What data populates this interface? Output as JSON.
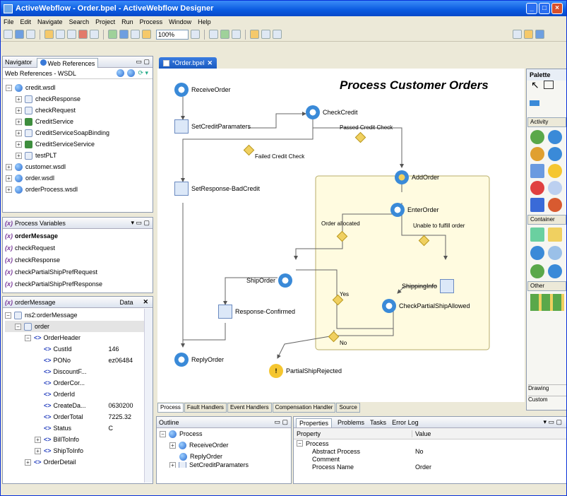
{
  "window": {
    "title": "ActiveWebflow - Order.bpel - ActiveWebflow Designer"
  },
  "menu": [
    "File",
    "Edit",
    "Navigate",
    "Search",
    "Project",
    "Run",
    "Process",
    "Window",
    "Help"
  ],
  "toolbar": {
    "zoom": "100%"
  },
  "navigator": {
    "tabs": [
      "Navigator",
      "Web References"
    ],
    "subtitle": "Web References - WSDL",
    "items": [
      {
        "label": "credit.wsdl",
        "level": 0,
        "exp": "−",
        "icon": "globe"
      },
      {
        "label": "checkResponse",
        "level": 1,
        "exp": "+",
        "icon": "doc"
      },
      {
        "label": "checkRequest",
        "level": 1,
        "exp": "+",
        "icon": "doc"
      },
      {
        "label": "CreditService",
        "level": 1,
        "exp": "+",
        "icon": "svc"
      },
      {
        "label": "CreditServiceSoapBinding",
        "level": 1,
        "exp": "+",
        "icon": "doc"
      },
      {
        "label": "CreditServiceService",
        "level": 1,
        "exp": "+",
        "icon": "svc"
      },
      {
        "label": "testPLT",
        "level": 1,
        "exp": "+",
        "icon": "doc"
      },
      {
        "label": "customer.wsdl",
        "level": 0,
        "exp": "+",
        "icon": "globe"
      },
      {
        "label": "order.wsdl",
        "level": 0,
        "exp": "+",
        "icon": "globe"
      },
      {
        "label": "orderProcess.wsdl",
        "level": 0,
        "exp": "+",
        "icon": "globe"
      }
    ]
  },
  "variables": {
    "title": "Process Variables",
    "items": [
      "orderMessage",
      "checkRequest",
      "checkResponse",
      "checkPartialShipPrefRequest",
      "checkPartialShipPrefResponse"
    ]
  },
  "data_view": {
    "title": "orderMessage",
    "col": "Data",
    "rows": [
      {
        "label": "ns2:orderMessage",
        "level": 0,
        "exp": "−",
        "value": ""
      },
      {
        "label": "order",
        "level": 1,
        "exp": "−",
        "value": ""
      },
      {
        "label": "OrderHeader",
        "level": 2,
        "exp": "−",
        "value": ""
      },
      {
        "label": "CustId",
        "level": 3,
        "exp": "",
        "value": "146"
      },
      {
        "label": "PONo",
        "level": 3,
        "exp": "",
        "value": "ez06484"
      },
      {
        "label": "DiscountF...",
        "level": 3,
        "exp": "",
        "value": ""
      },
      {
        "label": "OrderCor...",
        "level": 3,
        "exp": "",
        "value": ""
      },
      {
        "label": "OrderId",
        "level": 3,
        "exp": "",
        "value": ""
      },
      {
        "label": "CreateDa...",
        "level": 3,
        "exp": "",
        "value": "0630200"
      },
      {
        "label": "OrderTotal",
        "level": 3,
        "exp": "",
        "value": "7225.32"
      },
      {
        "label": "Status",
        "level": 3,
        "exp": "",
        "value": "C"
      },
      {
        "label": "BillToInfo",
        "level": 3,
        "exp": "+",
        "value": ""
      },
      {
        "label": "ShipToInfo",
        "level": 3,
        "exp": "+",
        "value": ""
      },
      {
        "label": "OrderDetail",
        "level": 2,
        "exp": "+",
        "value": ""
      }
    ]
  },
  "editor": {
    "tab": "*Order.bpel",
    "title": "Process Customer Orders",
    "nodes": {
      "receive": "ReceiveOrder",
      "setcredit": "SetCreditParamaters",
      "checkcredit": "CheckCredit",
      "setresp": "SetResponse-BadCredit",
      "addorder": "AddOrder",
      "enterorder": "EnterOrder",
      "shiporder": "ShipOrder",
      "shipinfo": "ShippingInfo",
      "confirmed": "Response-Confirmed",
      "checkpartial": "CheckPartialShipAllowed",
      "reply": "ReplyOrder",
      "rejected": "PartialShipRejected"
    },
    "links": {
      "passed": "Passed Credit Check",
      "failed": "Failed Credit Check",
      "allocated": "Order allocated",
      "unable": "Unable to fulfill order",
      "yes": "Yes",
      "no": "No"
    },
    "bottom_tabs": [
      "Process",
      "Fault Handlers",
      "Event Handlers",
      "Compensation Handler",
      "Source"
    ]
  },
  "palette": {
    "title": "Palette",
    "sections": [
      "Activity",
      "Container",
      "Other"
    ],
    "footer": [
      "Drawing",
      "Custom"
    ]
  },
  "outline": {
    "title": "Outline",
    "items": [
      "Process",
      "ReceiveOrder",
      "ReplyOrder",
      "SetCreditParamaters"
    ]
  },
  "properties": {
    "tabs": [
      "Properties",
      "Problems",
      "Tasks",
      "Error Log"
    ],
    "cols": [
      "Property",
      "Value"
    ],
    "group": "Process",
    "rows": [
      {
        "k": "Abstract Process",
        "v": "No"
      },
      {
        "k": "Comment",
        "v": ""
      },
      {
        "k": "Process Name",
        "v": "Order"
      }
    ]
  }
}
